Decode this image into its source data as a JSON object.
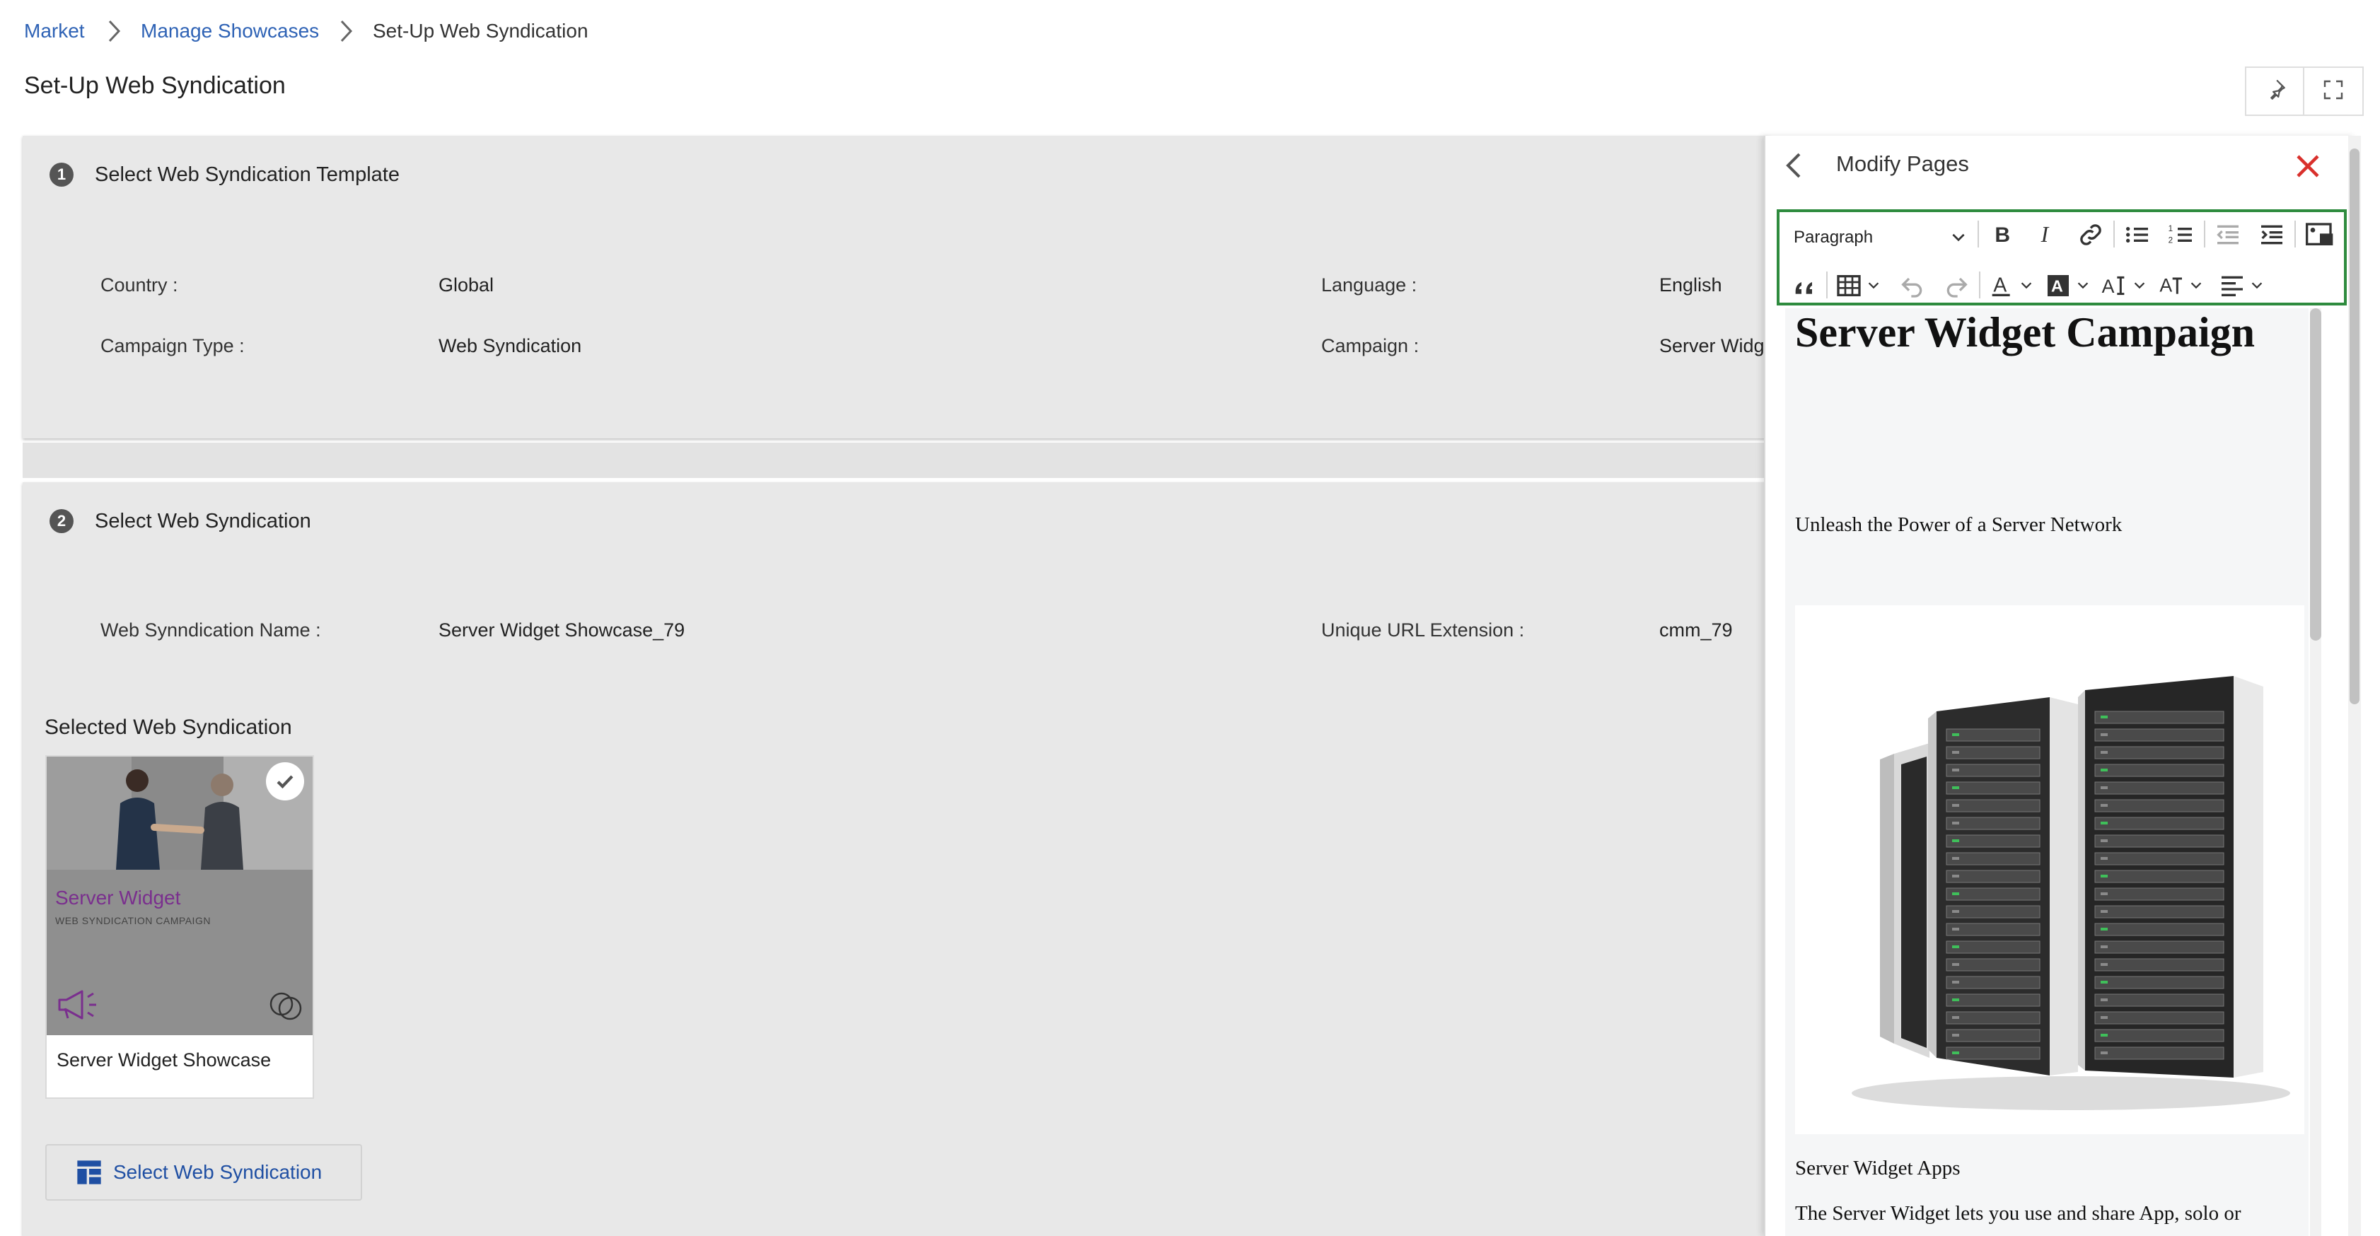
{
  "breadcrumb": {
    "items": [
      "Market",
      "Manage Showcases",
      "Set-Up Web Syndication"
    ]
  },
  "page": {
    "title": "Set-Up Web Syndication"
  },
  "step1": {
    "number": "1",
    "title": "Select Web Syndication Template",
    "country_label": "Country :",
    "country_value": "Global",
    "language_label": "Language :",
    "language_value": "English",
    "campaign_type_label": "Campaign Type :",
    "campaign_type_value": "Web Syndication",
    "campaign_label": "Campaign :",
    "campaign_value": "Server Widg"
  },
  "step2": {
    "number": "2",
    "title": "Select Web Syndication",
    "name_label": "Web Synndication Name :",
    "name_value": "Server Widget Showcase_79",
    "url_label": "Unique URL Extension :",
    "url_value": "cmm_79",
    "selected_heading": "Selected Web Syndication",
    "thumb_brand": "Server Widget",
    "thumb_sub": "WEB SYNDICATION CAMPAIGN",
    "thumb_label": "Server Widget Showcase",
    "select_button_label": "Select Web Syndication"
  },
  "panel": {
    "title": "Modify Pages",
    "toolbar": {
      "paragraph_select": "Paragraph"
    },
    "content": {
      "heading": "Server Widget Campaign",
      "tagline": "Unleash the Power of a Server Network",
      "apps_heading": "Server Widget Apps",
      "apps_text": "The Server Widget lets you use and share App, solo or"
    }
  },
  "colors": {
    "link": "#2e62b5",
    "toolbar_border": "#2e8b3e",
    "close_icon": "#d9302c",
    "brand_purple": "#7a2f8e"
  }
}
